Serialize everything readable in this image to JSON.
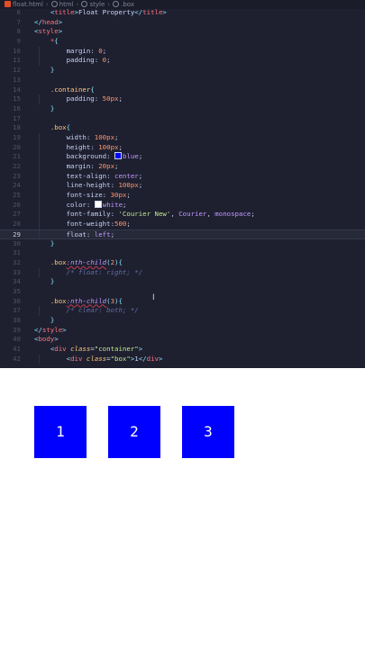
{
  "breadcrumb": {
    "items": [
      "float.html",
      "html",
      "style",
      ".box"
    ],
    "icons": [
      "html-file-icon",
      "tag-icon",
      "tag-icon",
      "css-selector-icon"
    ]
  },
  "editor": {
    "lines": [
      {
        "n": "6",
        "html": "    <span class=\"punc\">&lt;</span><span class=\"tag\">title</span><span class=\"punc\">&gt;</span>Float Property<span class=\"punc\">&lt;/</span><span class=\"tag\">title</span><span class=\"punc\">&gt;</span>"
      },
      {
        "n": "7",
        "html": "<span class=\"punc\">&lt;/</span><span class=\"tag\">head</span><span class=\"punc\">&gt;</span>"
      },
      {
        "n": "8",
        "html": "<span class=\"punc\">&lt;</span><span class=\"tag\">style</span><span class=\"punc\">&gt;</span>"
      },
      {
        "n": "9",
        "html": "    <span class=\"tag\">*</span><span class=\"punc\">{</span>"
      },
      {
        "n": "10",
        "html": "        <span class=\"prop\">margin</span>: <span class=\"num\">0</span>;"
      },
      {
        "n": "11",
        "html": "        <span class=\"prop\">padding</span>: <span class=\"num\">0</span>;"
      },
      {
        "n": "12",
        "html": "    <span class=\"punc\">}</span>"
      },
      {
        "n": "13",
        "html": ""
      },
      {
        "n": "14",
        "html": "    <span class=\"sel\">.container</span><span class=\"punc\">{</span>"
      },
      {
        "n": "15",
        "html": "        <span class=\"prop\">padding</span>: <span class=\"num\">50px</span>;"
      },
      {
        "n": "16",
        "html": "    <span class=\"punc\">}</span>"
      },
      {
        "n": "17",
        "html": ""
      },
      {
        "n": "18",
        "html": "    <span class=\"sel\">.box</span><span class=\"punc\">{</span>"
      },
      {
        "n": "19",
        "html": "        <span class=\"prop\">width</span>: <span class=\"num\">100px</span>;"
      },
      {
        "n": "20",
        "html": "        <span class=\"prop\">height</span>: <span class=\"num\">100px</span>;"
      },
      {
        "n": "21",
        "html": "        <span class=\"prop\">background</span>: <span class=\"swatch\" style=\"background:#0000ff\"></span><span class=\"kw\">blue</span>;"
      },
      {
        "n": "22",
        "html": "        <span class=\"prop\">margin</span>: <span class=\"num\">20px</span>;"
      },
      {
        "n": "23",
        "html": "        <span class=\"prop\">text-align</span>: <span class=\"kw\">center</span>;"
      },
      {
        "n": "24",
        "html": "        <span class=\"prop\">line-height</span>: <span class=\"num\">100px</span>;"
      },
      {
        "n": "25",
        "html": "        <span class=\"prop\">font-size</span>: <span class=\"num\">30px</span>;"
      },
      {
        "n": "26",
        "html": "        <span class=\"prop\">color</span>: <span class=\"swatch\" style=\"background:#ffffff\"></span><span class=\"kw\">white</span>;"
      },
      {
        "n": "27",
        "html": "        <span class=\"prop\">font-family</span>: <span class=\"str\">'Courier New'</span>, <span class=\"kw\">Courier</span>, <span class=\"kw\">monospace</span>;"
      },
      {
        "n": "28",
        "html": "        <span class=\"prop\">font-weight</span>:<span class=\"num\">500</span>;"
      },
      {
        "n": "29",
        "html": "        <span class=\"prop\">float</span>: <span class=\"kw\">left</span>;",
        "active": true
      },
      {
        "n": "30",
        "html": "    <span class=\"punc\">}</span>"
      },
      {
        "n": "31",
        "html": ""
      },
      {
        "n": "32",
        "html": "    <span class=\"sel\">.box</span><span class=\"pseudo\">:nth-child</span><span class=\"punc\">(</span><span class=\"num\">2</span><span class=\"punc\">){</span>"
      },
      {
        "n": "33",
        "html": "        <span class=\"com\">/* float: right; */</span>"
      },
      {
        "n": "34",
        "html": "    <span class=\"punc\">}</span>"
      },
      {
        "n": "35",
        "html": ""
      },
      {
        "n": "36",
        "html": "    <span class=\"sel\">.box</span><span class=\"pseudo\">:nth-child</span><span class=\"punc\">(</span><span class=\"num\">3</span><span class=\"punc\">){</span>"
      },
      {
        "n": "37",
        "html": "        <span class=\"com\">/* clear: both; */</span>"
      },
      {
        "n": "38",
        "html": "    <span class=\"punc\">}</span>"
      },
      {
        "n": "39",
        "html": "<span class=\"punc\">&lt;/</span><span class=\"tag\">style</span><span class=\"punc\">&gt;</span>"
      },
      {
        "n": "40",
        "html": "<span class=\"punc\">&lt;</span><span class=\"tag\">body</span><span class=\"punc\">&gt;</span>"
      },
      {
        "n": "41",
        "html": "    <span class=\"punc\">&lt;</span><span class=\"tag\">div</span> <span class=\"attr\">class</span>=<span class=\"str\">\"container\"</span><span class=\"punc\">&gt;</span>"
      },
      {
        "n": "42",
        "html": "        <span class=\"punc\">&lt;</span><span class=\"tag\">div</span> <span class=\"attr\">class</span>=<span class=\"str\">\"box\"</span><span class=\"punc\">&gt;</span>1<span class=\"punc\">&lt;/</span><span class=\"tag\">div</span><span class=\"punc\">&gt;</span>"
      }
    ]
  },
  "preview": {
    "boxes": [
      "1",
      "2",
      "3"
    ],
    "box_color": "#0000ff",
    "text_color": "#ffffff"
  }
}
